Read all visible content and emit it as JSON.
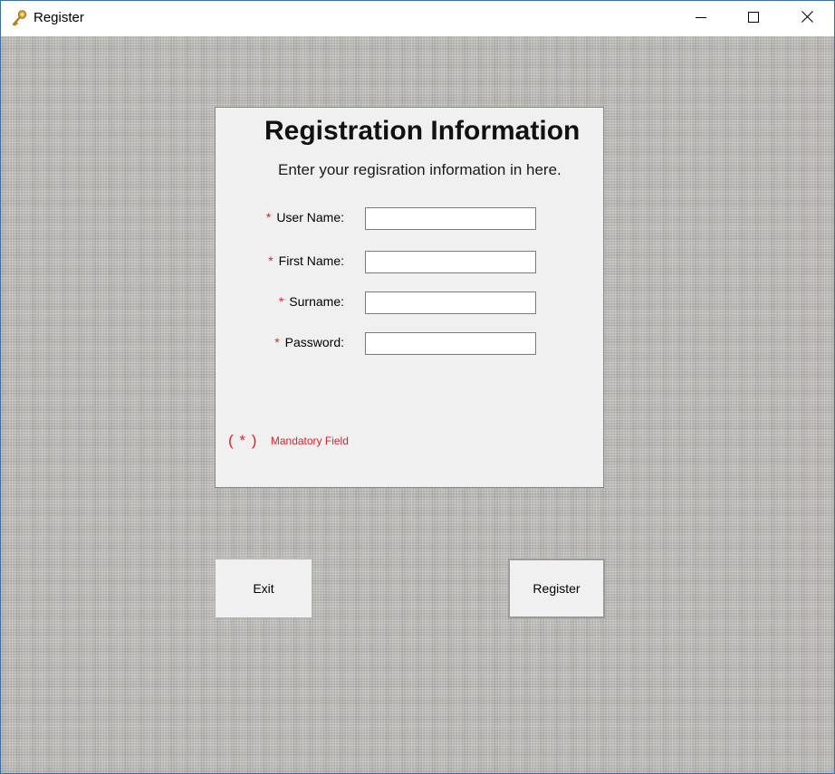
{
  "window": {
    "title": "Register",
    "title_icon": "keys-icon",
    "controls": {
      "minimize": "minimize-icon",
      "maximize": "maximize-icon",
      "close": "close-icon"
    }
  },
  "form": {
    "title": "Registration Information",
    "subtitle": "Enter your regisration information in here.",
    "required_marker": "*",
    "fields": [
      {
        "label": "User Name:",
        "value": ""
      },
      {
        "label": "First Name:",
        "value": ""
      },
      {
        "label": "Surname:",
        "value": ""
      },
      {
        "label": "Password:",
        "value": ""
      }
    ],
    "mandatory_note": {
      "mark": "( * )",
      "text": "Mandatory Field"
    }
  },
  "buttons": {
    "exit_label": "Exit",
    "register_label": "Register"
  },
  "colors": {
    "required": "#e0202a",
    "panel_background": "#f0f0f0"
  }
}
